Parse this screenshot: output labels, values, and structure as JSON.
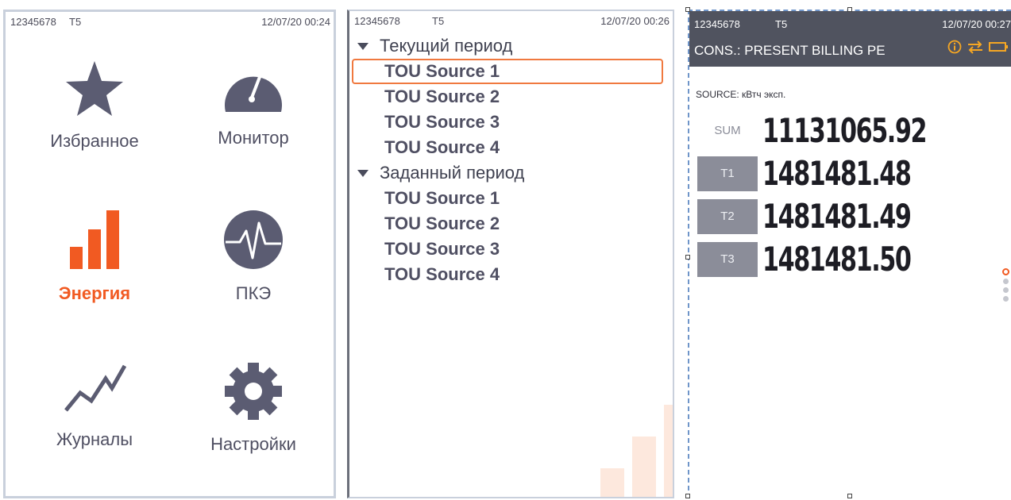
{
  "menu_screen": {
    "status": {
      "device_id": "12345678",
      "tariff": "T5",
      "datetime": "12/07/20 00:24"
    },
    "tiles": [
      {
        "label": "Избранное",
        "icon": "star-icon"
      },
      {
        "label": "Монитор",
        "icon": "gauge-icon"
      },
      {
        "label": "Энергия",
        "icon": "energy-bars-icon"
      },
      {
        "label": "ПКЭ",
        "icon": "pulse-icon"
      },
      {
        "label": "Журналы",
        "icon": "trend-line-icon"
      },
      {
        "label": "Настройки",
        "icon": "gear-icon"
      }
    ],
    "active_tile": "Энергия",
    "accent_color": "#f15a22"
  },
  "tree_screen": {
    "status": {
      "device_id": "12345678",
      "tariff": "T5",
      "datetime": "12/07/20 00:26"
    },
    "groups": [
      {
        "label": "Текущий период",
        "items": [
          "TOU Source 1",
          "TOU Source 2",
          "TOU Source 3",
          "TOU Source 4"
        ]
      },
      {
        "label": "Заданный период",
        "items": [
          "TOU Source 1",
          "TOU Source 2",
          "TOU Source 3",
          "TOU Source 4"
        ]
      }
    ],
    "selected_item": "Текущий период / TOU Source 1"
  },
  "consumption_screen": {
    "status": {
      "device_id": "12345678",
      "tariff": "T5",
      "datetime": "12/07/20 00:27"
    },
    "title": "CONS.: PRESENT BILLING PE",
    "header_icons": [
      "info-icon",
      "transfer-arrows-icon",
      "battery-icon"
    ],
    "source_label": "SOURCE: кВтч эксп.",
    "rows": [
      {
        "tag": "SUM",
        "value": "11131065.92"
      },
      {
        "tag": "T1",
        "value": "1481481.48"
      },
      {
        "tag": "T2",
        "value": "1481481.49"
      },
      {
        "tag": "T3",
        "value": "1481481.50"
      }
    ],
    "page_dots": 4,
    "active_page": 1
  }
}
